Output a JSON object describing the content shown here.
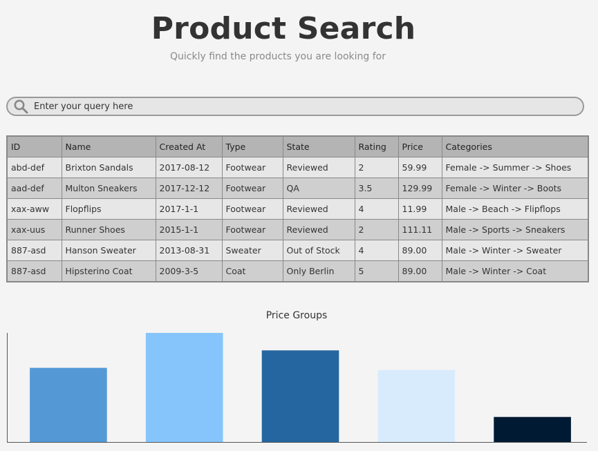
{
  "header": {
    "title": "Product Search",
    "subtitle": "Quickly find the products you are looking for"
  },
  "search": {
    "placeholder": "Enter your query here",
    "value": ""
  },
  "table": {
    "columns": [
      "ID",
      "Name",
      "Created At",
      "Type",
      "State",
      "Rating",
      "Price",
      "Categories"
    ],
    "rows": [
      [
        "abd-def",
        "Brixton Sandals",
        "2017-08-12",
        "Footwear",
        "Reviewed",
        "2",
        "59.99",
        "Female -> Summer -> Shoes"
      ],
      [
        "aad-def",
        "Multon Sneakers",
        "2017-12-12",
        "Footwear",
        "QA",
        "3.5",
        "129.99",
        "Female -> Winter -> Boots"
      ],
      [
        "xax-aww",
        "Flopflips",
        "2017-1-1",
        " Footwear",
        "Reviewed",
        "4",
        "11.99",
        "Male -> Beach -> Flipflops"
      ],
      [
        "xax-uus",
        "Runner Shoes",
        "2015-1-1",
        " Footwear",
        "Reviewed",
        "2",
        "111.11",
        "Male -> Sports -> Sneakers"
      ],
      [
        "887-asd",
        "Hanson Sweater",
        "2013-08-31",
        " Sweater",
        "Out of Stock",
        "4",
        "89.00",
        "Male -> Winter -> Sweater"
      ],
      [
        "887-asd",
        "Hipsterino Coat",
        "2009-3-5",
        "Coat",
        "Only Berlin",
        "5",
        "89.00",
        "Male -> Winter -> Coat"
      ]
    ]
  },
  "chart_data": {
    "type": "bar",
    "title": "Price Groups",
    "xlabel": "",
    "ylabel": "",
    "ylim": [
      0,
      100
    ],
    "values": [
      68,
      100,
      84,
      66,
      23
    ],
    "colors": [
      "#5499d6",
      "#86c5fb",
      "#2566a0",
      "#d8ebfc",
      "#011a33"
    ],
    "grid": false
  },
  "colors": {
    "background": "#f4f4f4",
    "header_row": "#b4b4b4",
    "row_odd": "#e7e7e7",
    "row_even": "#cfcfcf",
    "border": "#888888"
  }
}
